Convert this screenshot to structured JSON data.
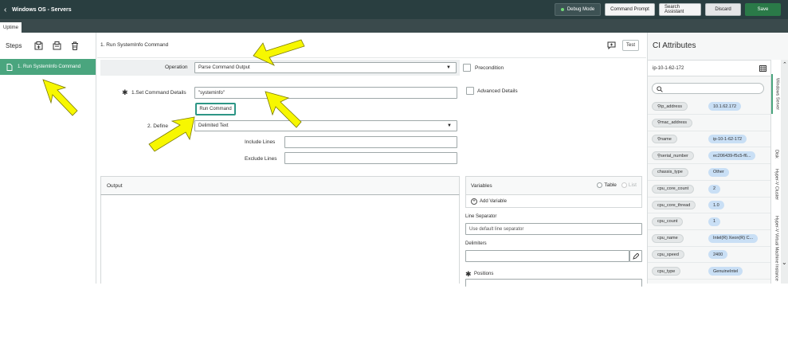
{
  "header": {
    "back_icon": "chevron-left-icon",
    "title": "Windows OS - Servers",
    "debug_mode": "Debug Mode",
    "command_prompt": "Command Prompt",
    "search_assistant": "Search Assistant",
    "discard": "Discard",
    "save": "Save"
  },
  "tabs": {
    "active": "Uptime"
  },
  "steps": {
    "label": "Steps",
    "item_number": "1.",
    "item_label": "Run SystemInfo Command"
  },
  "main": {
    "step_title": "1. Run SystemInfo Command",
    "test": "Test",
    "operation_label": "Operation",
    "operation_value": "Parse Command Output",
    "precondition": "Precondition",
    "set_command_label": "1.Set Command Details",
    "command_value": "\"systeminfo\"",
    "advanced_details": "Advanced Details",
    "run_command": "Run Command",
    "define_label": "2. Define",
    "define_value": "Delimited Text",
    "include_lines": "Include Lines",
    "exclude_lines": "Exclude Lines",
    "output": "Output",
    "variables": "Variables",
    "table": "Table",
    "list": "List",
    "add_variable": "Add Variable",
    "line_separator_label": "Line Separator",
    "line_separator_value": "Use default line separator",
    "delimiters_label": "Delimiters",
    "positions_label": "Positions"
  },
  "ci": {
    "title": "CI Attributes",
    "host": "ip-10-1-62-172",
    "attributes": [
      {
        "key": "ip_address",
        "value": "10.1.62.172",
        "icon": true
      },
      {
        "key": "mac_address",
        "value": "",
        "icon": true
      },
      {
        "key": "name",
        "value": "ip-10-1-62-172",
        "icon": true
      },
      {
        "key": "serial_number",
        "value": "ec206439-f5c5-f6...",
        "icon": true
      },
      {
        "key": "chassis_type",
        "value": "Other",
        "icon": false
      },
      {
        "key": "cpu_core_count",
        "value": "2",
        "icon": false
      },
      {
        "key": "cpu_core_thread",
        "value": "1.0",
        "icon": false
      },
      {
        "key": "cpu_count",
        "value": "1",
        "icon": false
      },
      {
        "key": "cpu_name",
        "value": "Intel(R) Xeon(R) C...",
        "icon": false
      },
      {
        "key": "cpu_speed",
        "value": "2400",
        "icon": false
      },
      {
        "key": "cpu_type",
        "value": "GenuineIntel",
        "icon": false
      }
    ],
    "vertical_tabs": [
      "Windows Server",
      "Disk",
      "Hyper-V Cluster",
      "Hyper-V Virtual Machine Instance"
    ]
  },
  "colors": {
    "header_bg": "#293e40",
    "step_active": "#4aa57e",
    "save_green": "#2a7a48",
    "arrow_yellow": "#f7f700"
  }
}
